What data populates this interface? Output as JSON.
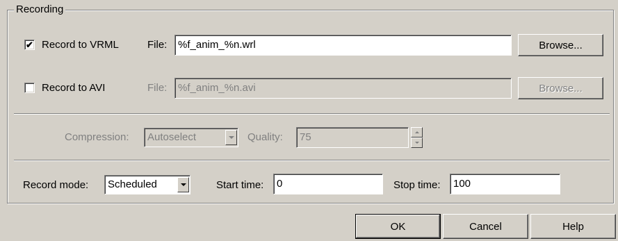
{
  "recording": {
    "group_title": "Recording",
    "vrml": {
      "checked": true,
      "check_mark": "✔",
      "label": "Record to VRML",
      "file_label": "File:",
      "file_value": "%f_anim_%n.wrl",
      "browse_label": "Browse..."
    },
    "avi": {
      "checked": false,
      "check_mark": "",
      "label": "Record to AVI",
      "file_label": "File:",
      "file_value": "%f_anim_%n.avi",
      "browse_label": "Browse..."
    },
    "compression": {
      "label": "Compression:",
      "value": "Autoselect",
      "quality_label": "Quality:",
      "quality_value": "75"
    },
    "record_mode": {
      "label": "Record mode:",
      "value": "Scheduled",
      "start_label": "Start time:",
      "start_value": "0",
      "stop_label": "Stop time:",
      "stop_value": "100"
    }
  },
  "footer": {
    "ok_label": "OK",
    "cancel_label": "Cancel",
    "help_label": "Help"
  },
  "icons": {
    "combo_arrow": "chevron-down-icon",
    "spin_up": "spin-up-icon",
    "spin_down": "spin-down-icon"
  }
}
